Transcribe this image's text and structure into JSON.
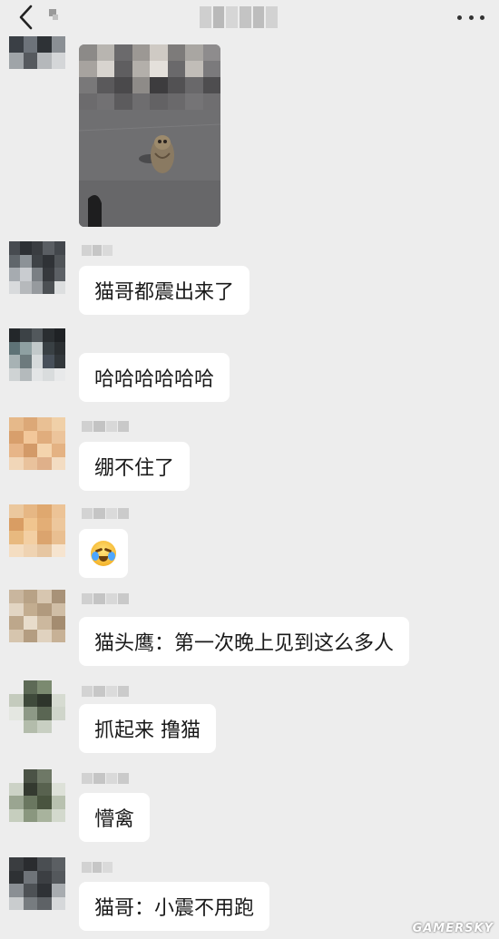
{
  "header": {
    "back_icon": "chevron-left-icon",
    "more_icon": "more-dots-icon"
  },
  "messages": [
    {
      "type": "image",
      "description": "owl on road"
    },
    {
      "type": "text",
      "text": "猫哥都震出来了"
    },
    {
      "type": "text",
      "text": "哈哈哈哈哈哈"
    },
    {
      "type": "text",
      "text": "绷不住了"
    },
    {
      "type": "emoji",
      "emoji": "laugh-cry-emoji"
    },
    {
      "type": "text",
      "text": "猫头鹰：第一次晚上见到这么多人"
    },
    {
      "type": "text",
      "text": "抓起来 撸猫"
    },
    {
      "type": "text",
      "text": "懵禽"
    },
    {
      "type": "text",
      "text": "猫哥：小震不用跑"
    }
  ],
  "watermark": "GAMERSKY",
  "colors": {
    "background": "#ededed",
    "bubble": "#ffffff",
    "text": "#1a1a1a"
  }
}
